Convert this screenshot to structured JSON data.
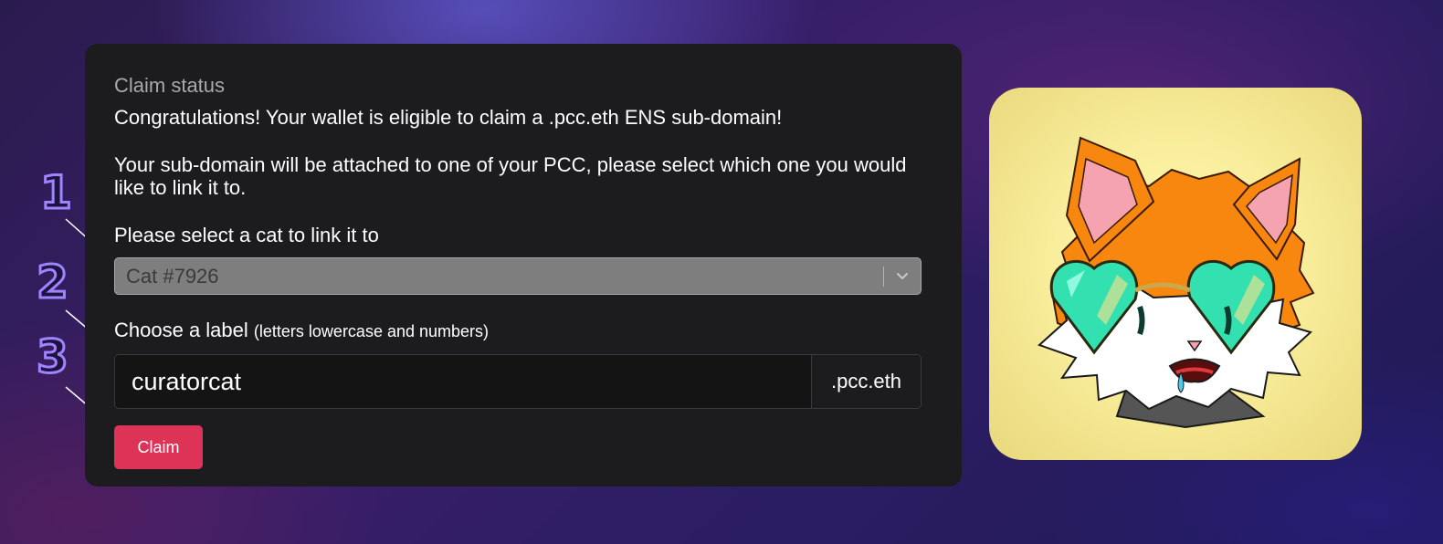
{
  "steps": [
    "1",
    "2",
    "3"
  ],
  "card": {
    "status_title": "Claim status",
    "congrats": "Congratulations! Your wallet is eligible to claim a .pcc.eth ENS sub-domain!",
    "explain": "Your sub-domain will be attached to one of your PCC, please select which one you would like to link it to.",
    "select_label": "Please select a cat to link it to",
    "select_value": "Cat #7926",
    "label_title": "Choose a label",
    "label_hint": "(letters lowercase and numbers)",
    "label_value": "curatorcat",
    "suffix": ".pcc.eth",
    "claim_button": "Claim"
  },
  "icons": {
    "select_chevron": "chevron-down-icon"
  },
  "colors": {
    "card_bg": "#1c1c1e",
    "claim_button": "#dd3357",
    "step_outline": "#9f83ff",
    "tile_bg": "#f9ee9c"
  },
  "image": {
    "subject": "orange cat with heart-shaped sunglasses"
  }
}
